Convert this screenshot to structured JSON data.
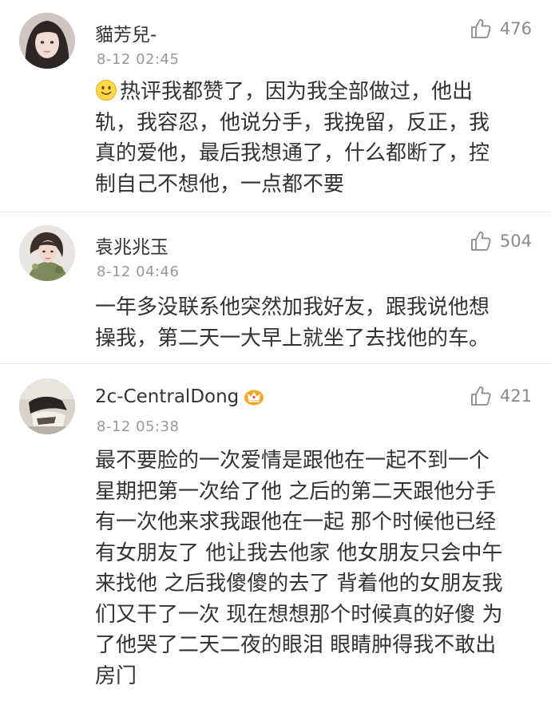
{
  "comments": [
    {
      "username": "貓芳兒-",
      "timestamp": "8-12 02:45",
      "likes": "476",
      "avatar_icon": "user-avatar-photo",
      "leading_emoji": "smile-emoji-icon",
      "lines": [
        "热评我都赞了，因为我全部做过，他出",
        "轨，我容忍，他说分手，我挽留，反正，我",
        "真的爱他，最后我想通了，什么都断了，控",
        "制自己不想他，一点都不要"
      ]
    },
    {
      "username": "袁兆兆玉",
      "timestamp": "8-12 04:46",
      "likes": "504",
      "avatar_icon": "user-avatar-photo",
      "lines": [
        "一年多没联系他突然加我好友，跟我说他想",
        "操我，第二天一大早上就坐了去找他的车。"
      ]
    },
    {
      "username": "2c-CentralDong",
      "timestamp": "8-12 05:38",
      "likes": "421",
      "avatar_icon": "user-avatar-photo",
      "badge_icon": "vip-crown-badge-icon",
      "lines": [
        "最不要脸的一次爱情是跟他在一起不到一个",
        "星期把第一次给了他 之后的第二天跟他分手",
        "有一次他来求我跟他在一起 那个时候他已经",
        "有女朋友了 他让我去他家 他女朋友只会中午",
        "来找他 之后我傻傻的去了 背着他的女朋友我",
        "们又干了一次 现在想想那个时候真的好傻 为",
        "了他哭了二天二夜的眼泪 眼睛肿得我不敢出",
        "房门"
      ]
    }
  ],
  "colors": {
    "text": "#333333",
    "meta": "#999999",
    "like": "#8a8a8a",
    "divider": "#e6e6e6"
  }
}
